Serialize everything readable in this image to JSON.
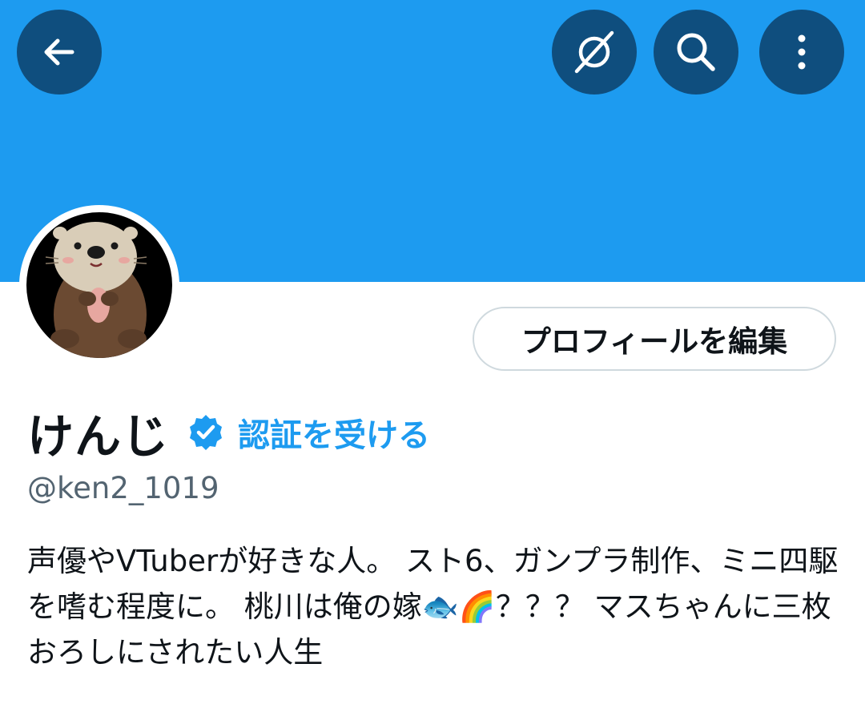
{
  "header": {
    "back_icon": "arrow-left-icon",
    "hide_icon": "eye-off-icon",
    "search_icon": "search-icon",
    "more_icon": "more-vertical-icon",
    "banner_color": "#1d9bf0",
    "button_color": "#0f4e7e"
  },
  "profile": {
    "avatar_icon": "sea-otter-avatar",
    "edit_button_label": "プロフィールを編集",
    "display_name": "けんじ",
    "verified_icon": "verified-badge-icon",
    "verify_link_label": "認証を受ける",
    "handle": "@ken2_1019",
    "bio": "声優やVTuberが好きな人。 スト6、ガンプラ制作、ミニ四駆を嗜む程度に。 桃川は俺の嫁🐟🌈？？？ マスちゃんに三枚おろしにされたい人生",
    "accent_color": "#1d9bf0"
  }
}
